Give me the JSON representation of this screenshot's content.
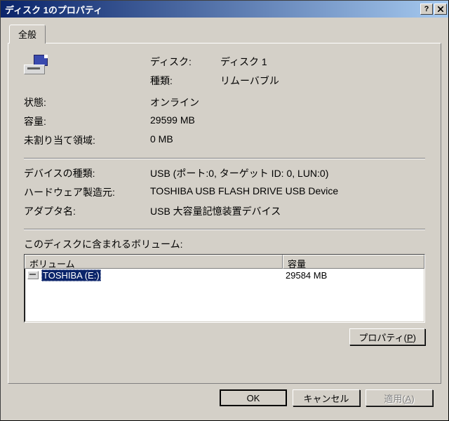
{
  "window": {
    "title": "ディスク 1のプロパティ"
  },
  "tabs": {
    "general": "全般"
  },
  "labels": {
    "disk": "ディスク:",
    "type": "種類:",
    "status": "状態:",
    "capacity": "容量:",
    "unallocated": "未割り当て領域:",
    "device_type": "デバイスの種類:",
    "manufacturer": "ハードウェア製造元:",
    "adapter": "アダプタ名:",
    "volumes_header": "このディスクに含まれるボリューム:"
  },
  "values": {
    "disk": "ディスク 1",
    "type": "リムーバブル",
    "status": "オンライン",
    "capacity": "29599 MB",
    "unallocated": "0 MB",
    "device_type": "USB (ポート:0, ターゲット ID: 0, LUN:0)",
    "manufacturer": "TOSHIBA USB FLASH DRIVE USB Device",
    "adapter": "USB 大容量記憶装置デバイス"
  },
  "listview": {
    "columns": {
      "volume": "ボリューム",
      "capacity": "容量"
    },
    "rows": [
      {
        "name": "TOSHIBA (E:)",
        "capacity": "29584 MB"
      }
    ]
  },
  "buttons": {
    "properties_pre": "プロパティ(",
    "properties_u": "P",
    "properties_post": ")",
    "ok": "OK",
    "cancel": "キャンセル",
    "apply_pre": "適用(",
    "apply_u": "A",
    "apply_post": ")"
  }
}
